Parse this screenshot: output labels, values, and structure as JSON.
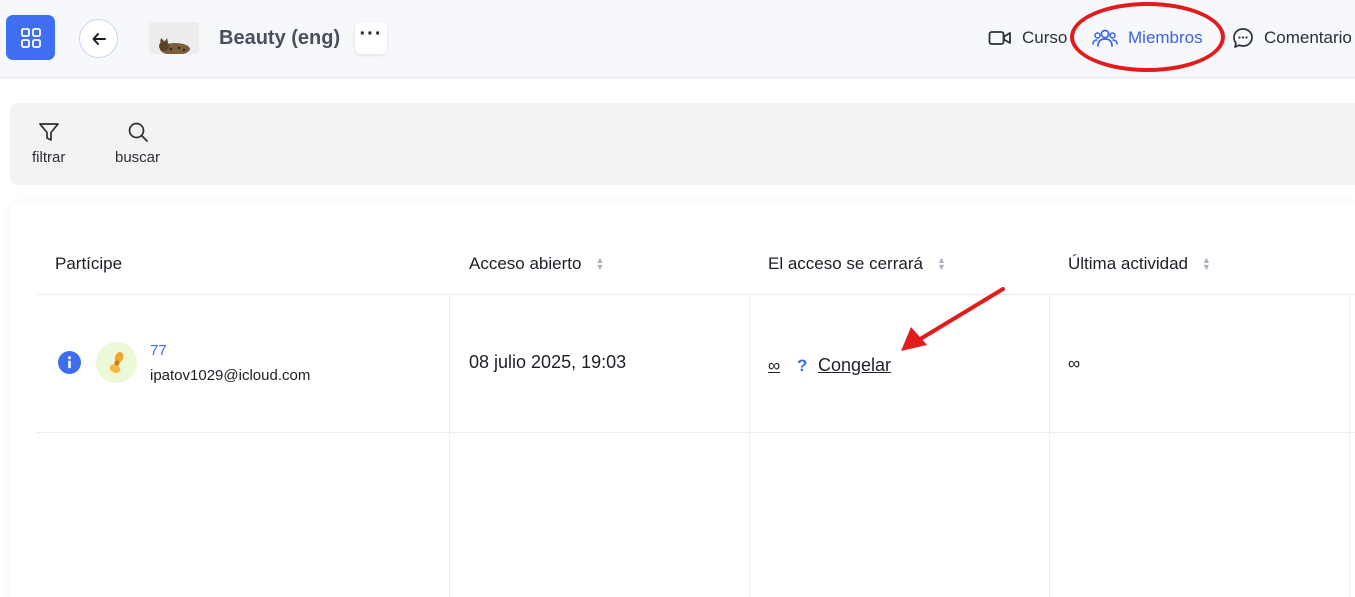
{
  "header": {
    "course_title": "Beauty (eng)",
    "more_label": "···",
    "nav": {
      "curso": "Curso",
      "miembros": "Miembros",
      "comentarios": "Comentario"
    },
    "active_tab": "Miembros",
    "accent_color": "#3f6ff0",
    "highlight_color": "#e01c1c"
  },
  "toolbar": {
    "filter_label": "filtrar",
    "search_label": "buscar"
  },
  "table": {
    "columns": {
      "participant": "Partícipe",
      "open_access": "Acceso abierto",
      "close_access": "El acceso se cerrará",
      "last_activity": "Última actividad"
    },
    "rows": [
      {
        "name": "77",
        "email": "ipatov1029@icloud.com",
        "open_access": "08 julio 2025, 19:03",
        "close_access": "∞",
        "help": "?",
        "freeze_label": "Congelar",
        "last_activity": "∞"
      }
    ]
  },
  "icons": [
    "apps-grid-icon",
    "arrow-left-icon",
    "more-icon",
    "video-icon",
    "users-icon",
    "comment-icon",
    "filter-icon",
    "search-icon",
    "info-icon",
    "flower-avatar-icon"
  ]
}
